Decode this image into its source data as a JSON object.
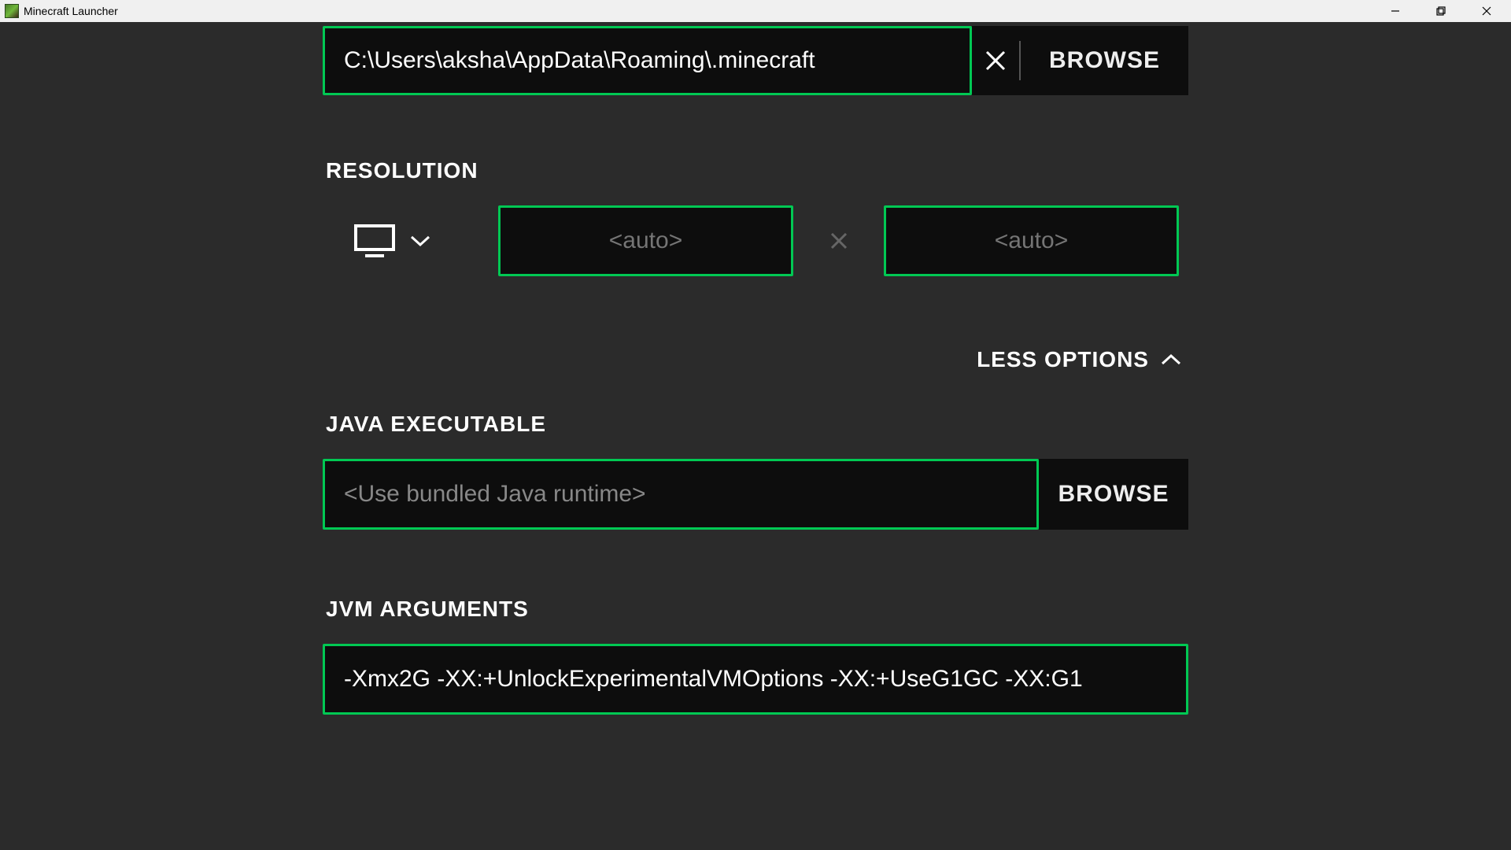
{
  "window": {
    "title": "Minecraft Launcher"
  },
  "game_dir": {
    "value": "C:\\Users\\aksha\\AppData\\Roaming\\.minecraft",
    "browse_label": "BROWSE"
  },
  "resolution": {
    "heading": "RESOLUTION",
    "width_placeholder": "<auto>",
    "height_placeholder": "<auto>",
    "width_value": "",
    "height_value": ""
  },
  "less_options_label": "LESS OPTIONS",
  "java_exec": {
    "heading": "JAVA EXECUTABLE",
    "placeholder": "<Use bundled Java runtime>",
    "value": "",
    "browse_label": "BROWSE"
  },
  "jvm_args": {
    "heading": "JVM ARGUMENTS",
    "value": "-Xmx2G -XX:+UnlockExperimentalVMOptions -XX:+UseG1GC -XX:G1"
  }
}
